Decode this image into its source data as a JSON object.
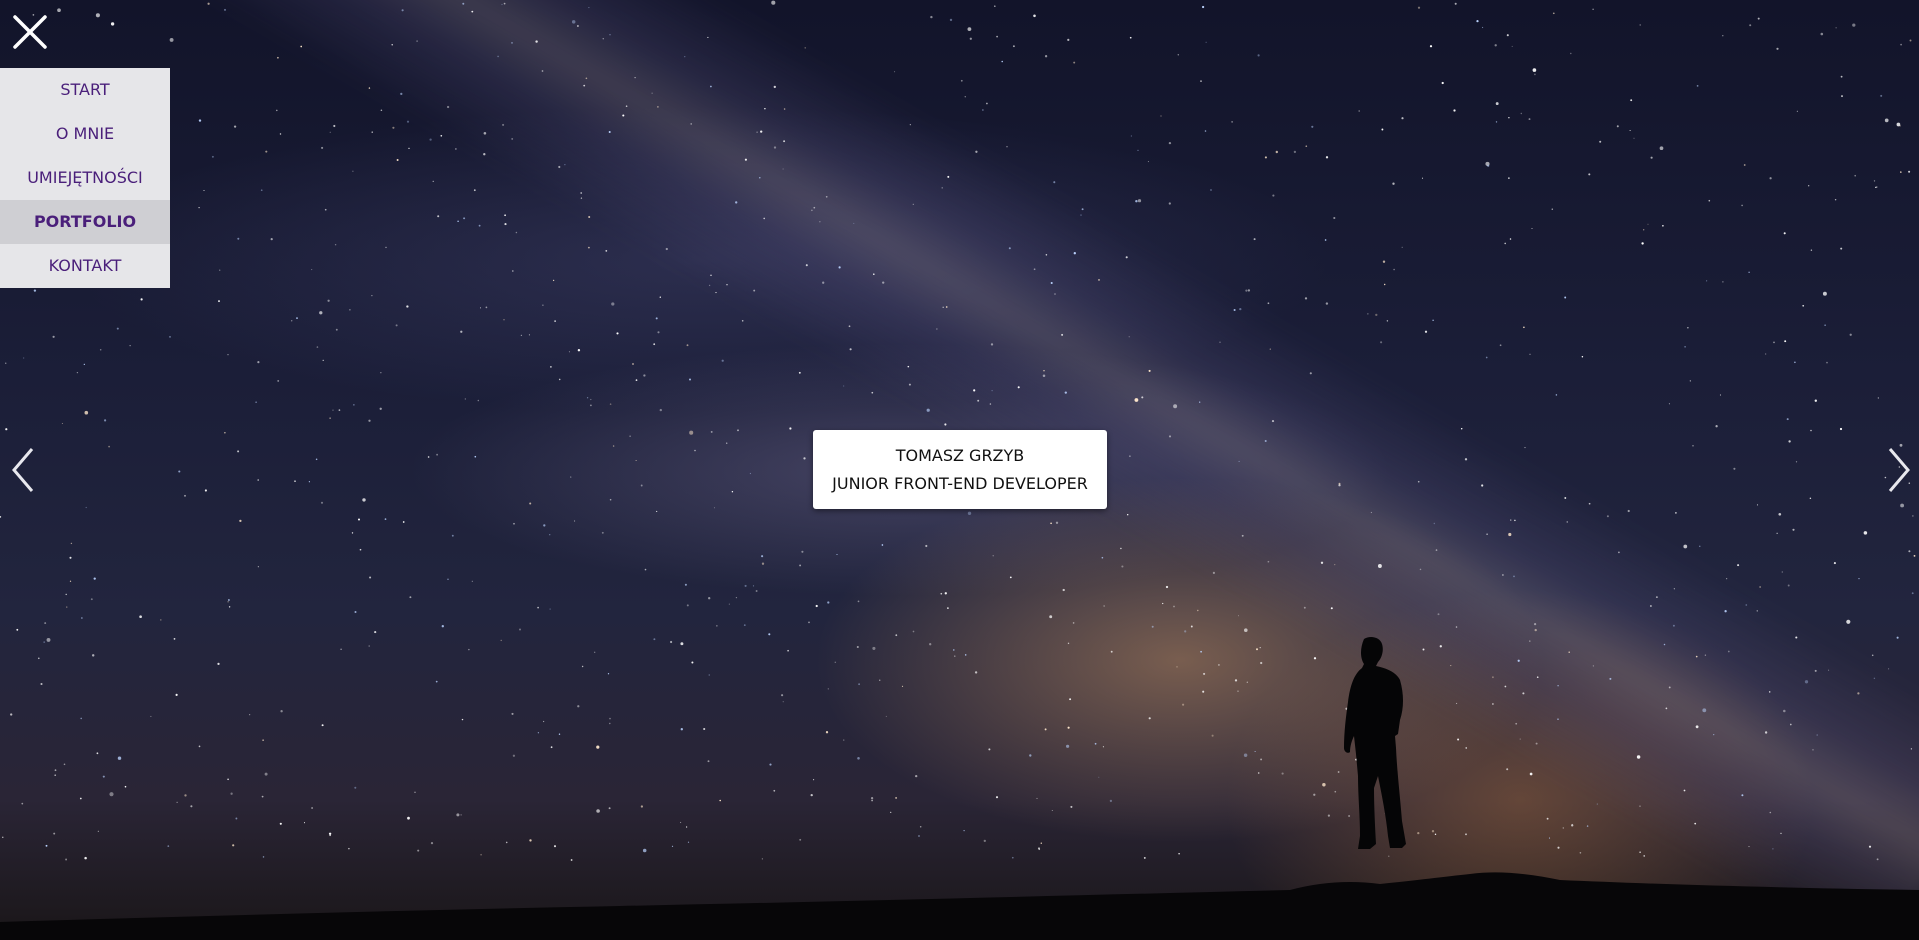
{
  "background": {
    "description_icon": "starry-sky-milky-way-background"
  },
  "close_button": {
    "icon": "close-icon"
  },
  "menu": {
    "items": [
      {
        "label": "START",
        "active": false
      },
      {
        "label": "O MNIE",
        "active": false
      },
      {
        "label": "UMIEJĘTNOŚCI",
        "active": false
      },
      {
        "label": "PORTFOLIO",
        "active": true
      },
      {
        "label": "KONTAKT",
        "active": false
      }
    ]
  },
  "slider": {
    "prev_icon": "chevron-left-icon",
    "next_icon": "chevron-right-icon"
  },
  "card": {
    "name": "TOMASZ GRZYB",
    "role": "JUNIOR FRONT-END DEVELOPER"
  },
  "colors": {
    "menu_text": "#4a1f7a",
    "menu_bg": "#e6e6e9",
    "menu_active_bg": "#cfcfd3"
  }
}
